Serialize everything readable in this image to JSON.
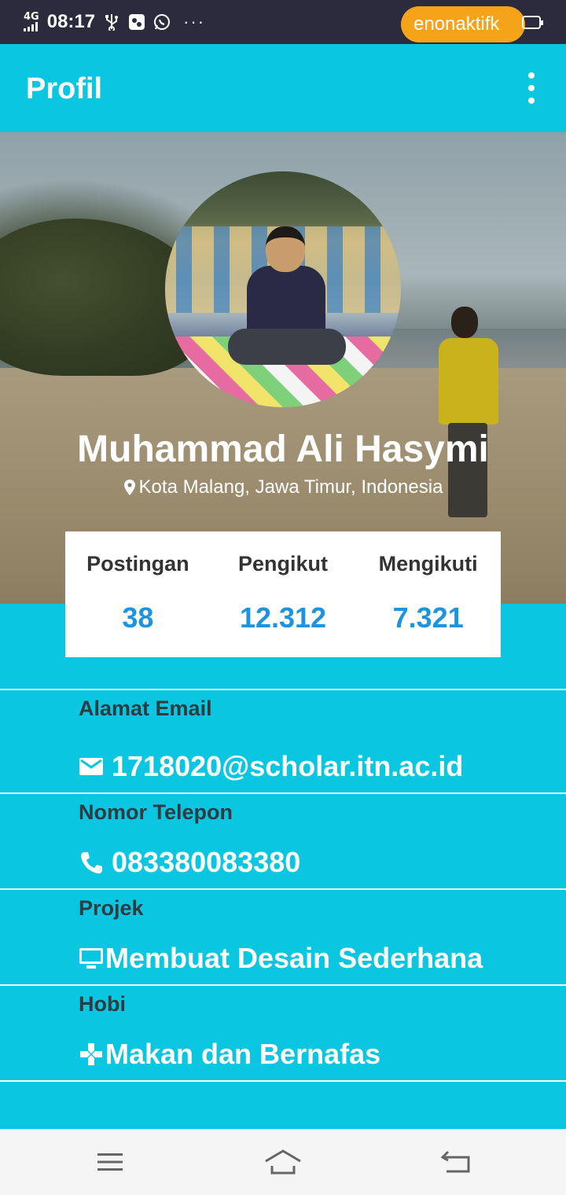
{
  "status_bar": {
    "network": "4G",
    "time": "08:17",
    "pill_text": "enonaktifk",
    "pill_color": "#f5a41a",
    "dots": "···"
  },
  "app_bar": {
    "title": "Profil",
    "background": "#0bc6e1"
  },
  "profile": {
    "name": "Muhammad Ali Hasymi",
    "location": "Kota Malang, Jawa Timur, Indonesia"
  },
  "stats": [
    {
      "label": "Postingan",
      "value": "38"
    },
    {
      "label": "Pengikut",
      "value": "12.312"
    },
    {
      "label": "Mengikuti",
      "value": "7.321"
    }
  ],
  "stat_value_color": "#1e93e0",
  "info": {
    "email": {
      "label": "Alamat Email",
      "value": "1718020@scholar.itn.ac.id",
      "icon": "email-icon"
    },
    "phone": {
      "label": "Nomor Telepon",
      "value": "083380083380",
      "icon": "phone-icon"
    },
    "project": {
      "label": "Projek",
      "value": "Membuat Desain Sederhana",
      "icon": "desktop-icon"
    },
    "hobby": {
      "label": "Hobi",
      "value": "Makan dan Bernafas",
      "icon": "gamepad-icon"
    }
  },
  "nav": {
    "menu_icon": "menu-icon",
    "home_icon": "home-icon",
    "back_icon": "back-icon"
  }
}
